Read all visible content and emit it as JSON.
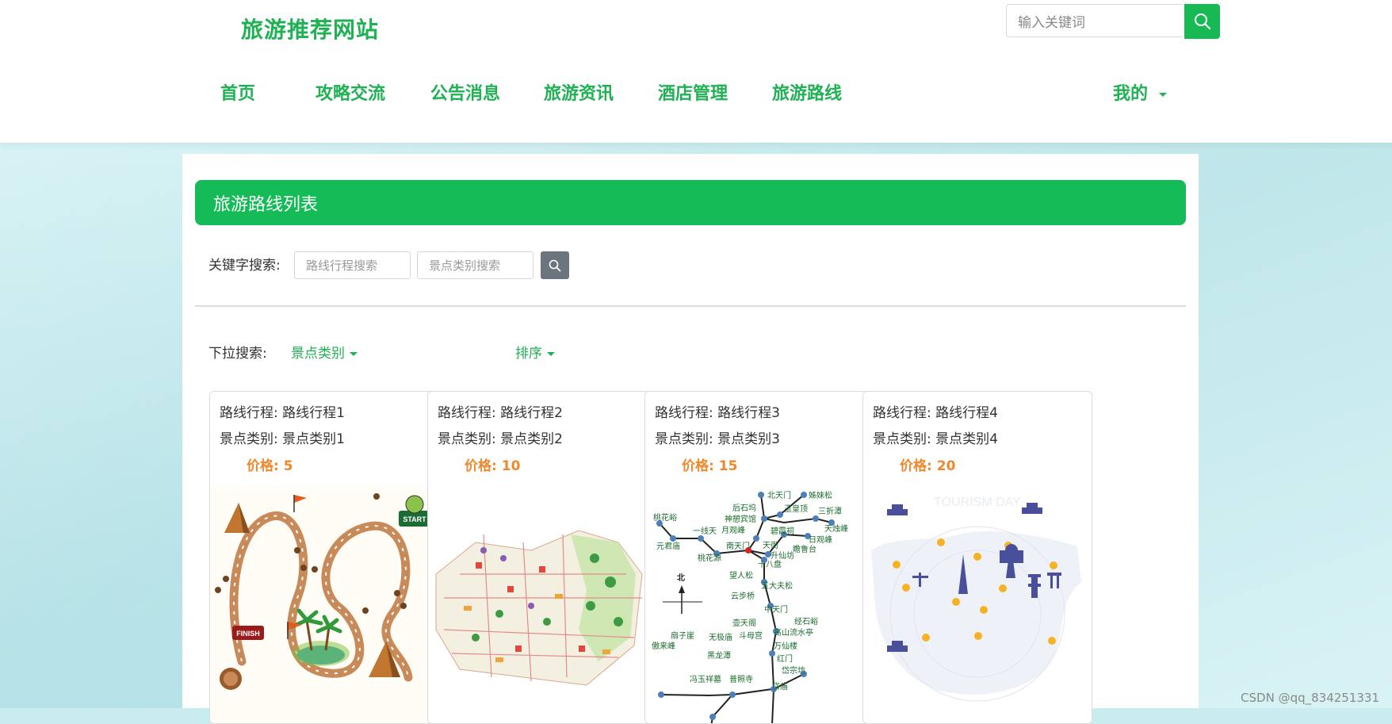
{
  "header": {
    "site_title": "旅游推荐网站",
    "search_placeholder": "输入关键词",
    "search_icon": "search-icon"
  },
  "nav": {
    "items": [
      "首页",
      "攻略交流",
      "公告消息",
      "旅游资讯",
      "酒店管理",
      "旅游路线"
    ],
    "my_label": "我的"
  },
  "panel": {
    "title": "旅游路线列表",
    "keyword_label": "关键字搜索:",
    "route_placeholder": "路线行程搜索",
    "category_placeholder": "景点类别搜索",
    "dropdown_label": "下拉搜索:",
    "category_dropdown": "景点类别",
    "sort_dropdown": "排序"
  },
  "cards": [
    {
      "route_label": "路线行程:",
      "route": "路线行程1",
      "category_label": "景点类别:",
      "category": "景点类别1",
      "price_label": "价格:",
      "price": "5"
    },
    {
      "route_label": "路线行程:",
      "route": "路线行程2",
      "category_label": "景点类别:",
      "category": "景点类别2",
      "price_label": "价格:",
      "price": "10"
    },
    {
      "route_label": "路线行程:",
      "route": "路线行程3",
      "category_label": "景点类别:",
      "category": "景点类别3",
      "price_label": "价格:",
      "price": "15"
    },
    {
      "route_label": "路线行程:",
      "route": "路线行程4",
      "category_label": "景点类别:",
      "category": "景点类别4",
      "price_label": "价格:",
      "price": "20"
    }
  ],
  "map3_labels": [
    "北天门",
    "姊妹松",
    "后石坞",
    "玉皇顶",
    "三折潭",
    "神憩宾馆",
    "天烛峰",
    "桃花峪",
    "月观峰",
    "碧霞祠",
    "日观峰",
    "一线天",
    "南天门",
    "天街",
    "瞻鲁台",
    "元君庙",
    "桃花源",
    "升仙坊",
    "十八盘",
    "望人松",
    "五大夫松",
    "云步桥",
    "中天门",
    "壶天阁",
    "经石峪",
    "扇子崖",
    "无极庙",
    "斗母宫",
    "高山流水亭",
    "傲来峰",
    "黑龙潭",
    "万仙楼",
    "红门",
    "冯玉祥墓",
    "普照寺",
    "岱宗坊",
    "岱庙",
    "北"
  ],
  "map4_caption": "TOURISM DAY",
  "watermark": "CSDN @qq_834251331",
  "colors": {
    "brand_green": "#16b954",
    "price_orange": "#f0872a",
    "button_gray": "#6c757d"
  }
}
